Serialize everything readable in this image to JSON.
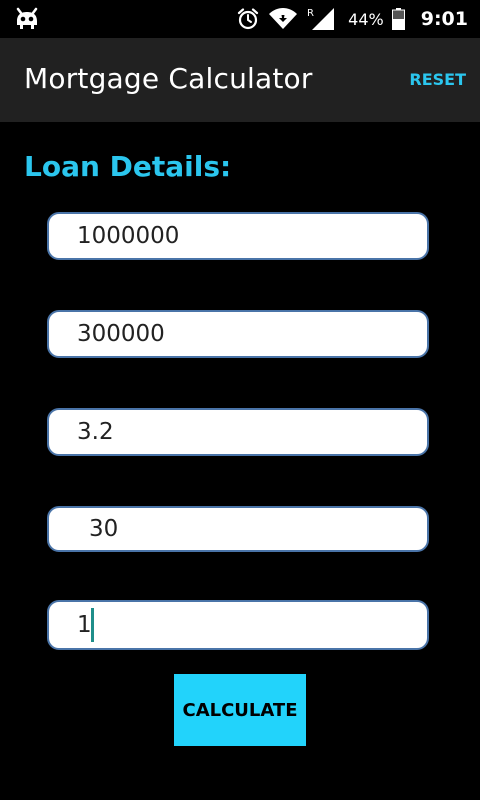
{
  "status_bar": {
    "battery": "44%",
    "time": "9:01",
    "icons": [
      "bug-icon",
      "alarm-icon",
      "wifi-icon",
      "signal-icon"
    ],
    "roaming_indicator": "R"
  },
  "action_bar": {
    "title": "Mortgage Calculator",
    "reset_label": "RESET"
  },
  "form": {
    "section_title": "Loan Details:",
    "fields": [
      {
        "value": "1000000"
      },
      {
        "value": "300000"
      },
      {
        "value": "3.2"
      },
      {
        "value": "30"
      },
      {
        "value": "1"
      }
    ],
    "calculate_label": "CALCULATE"
  },
  "colors": {
    "accent": "#2bc6ee",
    "button": "#22d3fb",
    "action_bar_bg": "#212121",
    "background": "#000000",
    "field_border": "#4a74a8"
  }
}
